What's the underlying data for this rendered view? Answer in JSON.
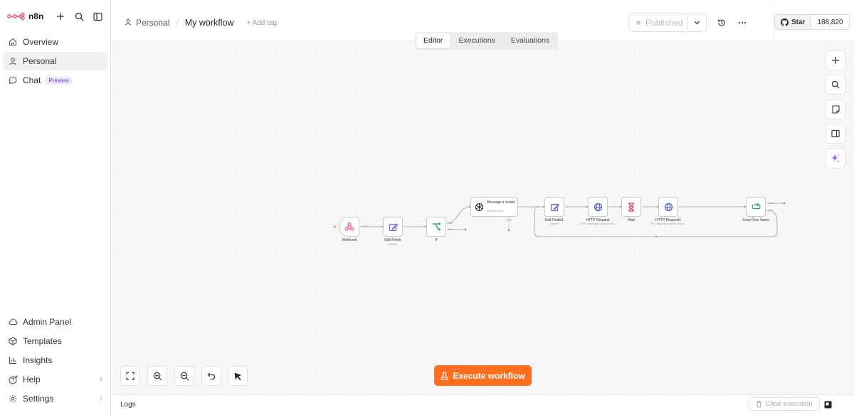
{
  "app": {
    "name": "n8n"
  },
  "sidebar": {
    "items": [
      {
        "label": "Overview",
        "icon": "home-icon"
      },
      {
        "label": "Personal",
        "icon": "user-icon"
      },
      {
        "label": "Chat",
        "icon": "chat-icon",
        "badge": "Preview"
      }
    ],
    "bottom_items": [
      {
        "label": "Admin Panel",
        "icon": "cloud-icon"
      },
      {
        "label": "Templates",
        "icon": "box-icon"
      },
      {
        "label": "Insights",
        "icon": "bar-chart-icon"
      },
      {
        "label": "Help",
        "icon": "help-icon"
      },
      {
        "label": "Settings",
        "icon": "gear-icon"
      }
    ]
  },
  "header": {
    "breadcrumb_project": "Personal",
    "workflow_name": "My workflow",
    "add_tag": "+ Add tag",
    "publish_label": "Published",
    "github_star": "Star",
    "github_count": "188,820"
  },
  "tabs": [
    {
      "label": "Editor",
      "active": true
    },
    {
      "label": "Executions",
      "active": false
    },
    {
      "label": "Evaluations",
      "active": false
    }
  ],
  "workflow": {
    "nodes": [
      {
        "label": "Webhook",
        "sub": ""
      },
      {
        "label": "Edit Fields",
        "sub": "manual"
      },
      {
        "label": "If",
        "sub": ""
      },
      {
        "label": "Message a model",
        "sub": "Response Text"
      },
      {
        "label": "Edit Fields1",
        "sub": "manual"
      },
      {
        "label": "HTTP Request",
        "sub": "POST: https://api.openai.com/v..."
      },
      {
        "label": "Wait",
        "sub": ""
      },
      {
        "label": "HTTP Request1",
        "sub": "GET: https://api.openai.com/v1..."
      },
      {
        "label": "Loop Over Items",
        "sub": ""
      }
    ],
    "port_labels": {
      "webhook_out": "POST",
      "if_true": "true",
      "if_false": "false",
      "model_tools": "Tools",
      "loop_done": "done",
      "loop_loop": "loop"
    }
  },
  "canvas": {
    "execute_label": "Execute workflow"
  },
  "logs": {
    "title": "Logs",
    "clear_label": "Clear execution"
  },
  "colors": {
    "accent": "#ff6d1f",
    "webhook": "#ff5a7e",
    "edit": "#6c5ce7",
    "if_green": "#1aa37a",
    "http": "#4a5bd6",
    "wait": "#e0345a",
    "preview_badge": "#6c3cd6"
  }
}
